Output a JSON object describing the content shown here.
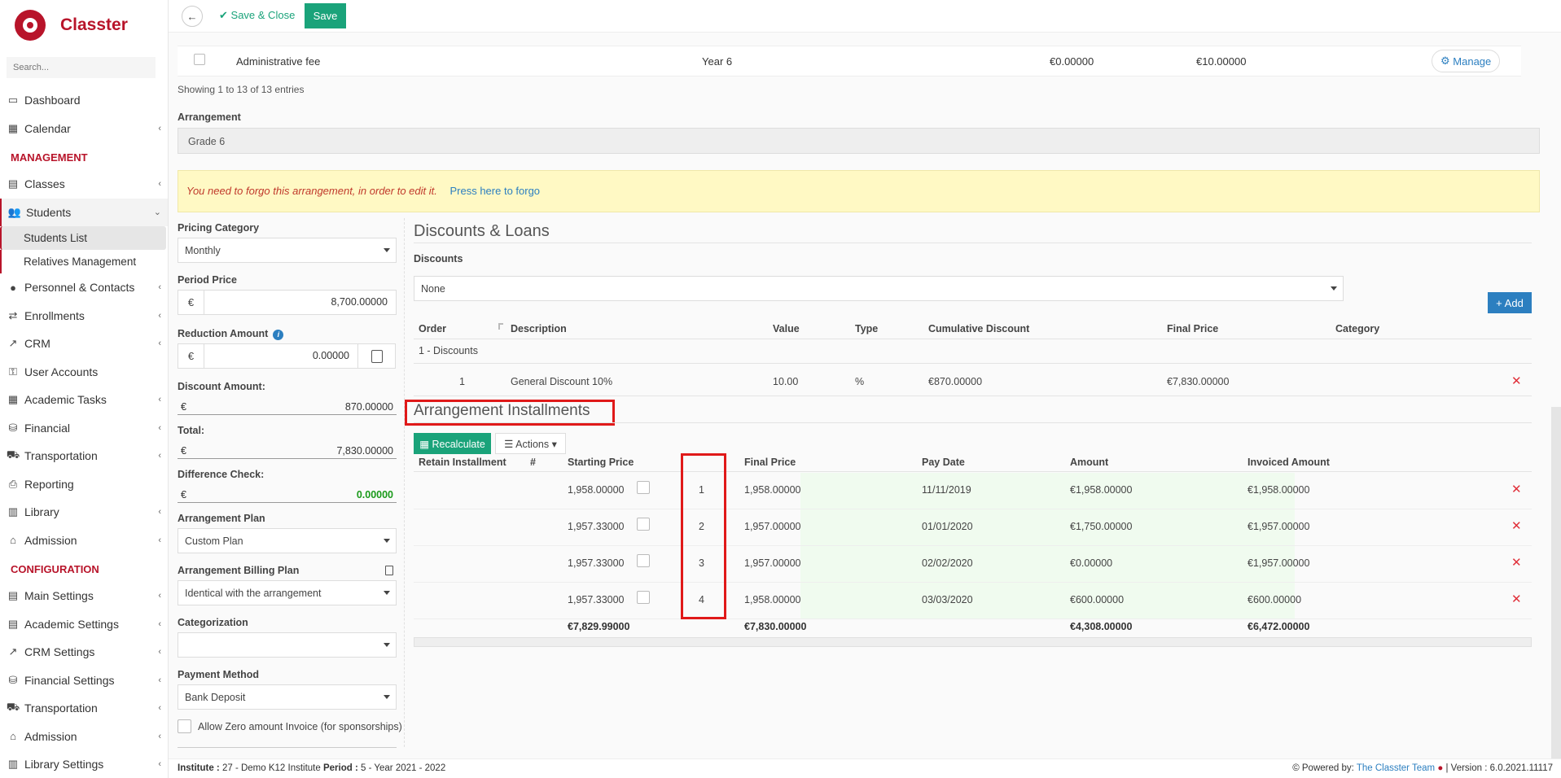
{
  "app": {
    "brand": "Classter",
    "search_placeholder": "Search..."
  },
  "sidebar": {
    "items_top": [
      {
        "label": "Dashboard",
        "icon": "laptop-icon"
      },
      {
        "label": "Calendar",
        "icon": "calendar-icon"
      }
    ],
    "section_management": "MANAGEMENT",
    "management_items": [
      {
        "label": "Classes",
        "icon": "grid-icon"
      },
      {
        "label": "Students",
        "icon": "users-icon"
      }
    ],
    "students_sub": [
      "Students List",
      "Relatives Management"
    ],
    "management_items_after": [
      {
        "label": "Personnel & Contacts",
        "icon": "user-icon"
      },
      {
        "label": "Enrollments",
        "icon": "exchange-icon"
      },
      {
        "label": "CRM",
        "icon": "chart-icon"
      },
      {
        "label": "User Accounts",
        "icon": "key-icon"
      },
      {
        "label": "Academic Tasks",
        "icon": "tasks-icon"
      },
      {
        "label": "Financial",
        "icon": "coins-icon"
      },
      {
        "label": "Transportation",
        "icon": "bus-icon"
      },
      {
        "label": "Reporting",
        "icon": "print-icon"
      },
      {
        "label": "Library",
        "icon": "books-icon"
      },
      {
        "label": "Admission",
        "icon": "bank-icon"
      }
    ],
    "section_configuration": "CONFIGURATION",
    "config_items": [
      {
        "label": "Main Settings",
        "icon": "grid-icon"
      },
      {
        "label": "Academic Settings",
        "icon": "grid-icon"
      },
      {
        "label": "CRM Settings",
        "icon": "chart-icon"
      },
      {
        "label": "Financial Settings",
        "icon": "coins-icon"
      },
      {
        "label": "Transportation",
        "icon": "bus-icon"
      },
      {
        "label": "Admission",
        "icon": "bank-icon"
      },
      {
        "label": "Library Settings",
        "icon": "books-icon"
      }
    ]
  },
  "toolbar": {
    "save_close_label": "Save & Close",
    "save_label": "Save"
  },
  "fees_table": {
    "row": {
      "description": "Administrative fee",
      "year": "Year 6",
      "price1": "€0.00000",
      "price2": "€10.00000",
      "manage_label": "Manage"
    },
    "showing": "Showing 1 to 13 of 13 entries"
  },
  "arrangement": {
    "label": "Arrangement",
    "value": "Grade 6",
    "warning": "You need to forgo this arrangement, in order to edit it.",
    "forgo_link": "Press here to forgo"
  },
  "form": {
    "pricing_category_label": "Pricing Category",
    "pricing_category_value": "Monthly",
    "period_price_label": "Period Price",
    "period_price_value": "8,700.00000",
    "reduction_amount_label": "Reduction Amount",
    "reduction_amount_value": "0.00000",
    "discount_amount_label": "Discount Amount:",
    "discount_amount_value": "870.00000",
    "total_label": "Total:",
    "total_value": "7,830.00000",
    "difference_check_label": "Difference Check:",
    "difference_check_value": "0.00000",
    "currency": "€",
    "arrangement_plan_label": "Arrangement Plan",
    "arrangement_plan_value": "Custom Plan",
    "billing_plan_label": "Arrangement Billing Plan",
    "billing_plan_value": "Identical with the arrangement",
    "categorization_label": "Categorization",
    "categorization_value": "",
    "payment_method_label": "Payment Method",
    "payment_method_value": "Bank Deposit",
    "allow_zero_label": "Allow Zero amount Invoice (for sponsorships)"
  },
  "discounts": {
    "title": "Discounts & Loans",
    "discounts_label": "Discounts",
    "discounts_value": "None",
    "add_label": "Add",
    "columns": [
      "Order",
      "Description",
      "Value",
      "Type",
      "Cumulative Discount",
      "Final Price",
      "Category"
    ],
    "group_label": "1 - Discounts",
    "rows": [
      {
        "order": "1",
        "description": "General Discount 10%",
        "value": "10.00",
        "type": "%",
        "cumulative": "€870.00000",
        "final": "€7,830.00000",
        "category": ""
      }
    ]
  },
  "installments": {
    "title": "Arrangement Installments",
    "recalculate_label": "Recalculate",
    "actions_label": "Actions",
    "columns": [
      "Retain Installment",
      "#",
      "Starting Price",
      "Final Price",
      "Pay Date",
      "Amount",
      "Invoiced Amount"
    ],
    "rows": [
      {
        "num": "1",
        "starting": "1,958.00000",
        "final": "1,958.00000",
        "date": "11/11/2019",
        "amount": "€1,958.00000",
        "invoiced": "€1,958.00000"
      },
      {
        "num": "2",
        "starting": "1,957.33000",
        "final": "1,957.00000",
        "date": "01/01/2020",
        "amount": "€1,750.00000",
        "invoiced": "€1,957.00000"
      },
      {
        "num": "3",
        "starting": "1,957.33000",
        "final": "1,957.00000",
        "date": "02/02/2020",
        "amount": "€0.00000",
        "invoiced": "€1,957.00000"
      },
      {
        "num": "4",
        "starting": "1,957.33000",
        "final": "1,958.00000",
        "date": "03/03/2020",
        "amount": "€600.00000",
        "invoiced": "€600.00000"
      }
    ],
    "totals": {
      "starting": "€7,829.99000",
      "final": "€7,830.00000",
      "amount": "€4,308.00000",
      "invoiced": "€6,472.00000"
    }
  },
  "footer": {
    "institute_label": "Institute :",
    "institute_value": "27 - Demo K12 Institute",
    "period_label": "Period :",
    "period_value": "5 - Year 2021 - 2022",
    "powered_by": "Powered by:",
    "team_link": "The Classter Team",
    "version": "| Version : 6.0.2021.11117"
  },
  "colors": {
    "brand": "#b8142a",
    "green": "#1aa37a",
    "blue": "#2c7fc0",
    "highlight_red": "#e01919"
  }
}
